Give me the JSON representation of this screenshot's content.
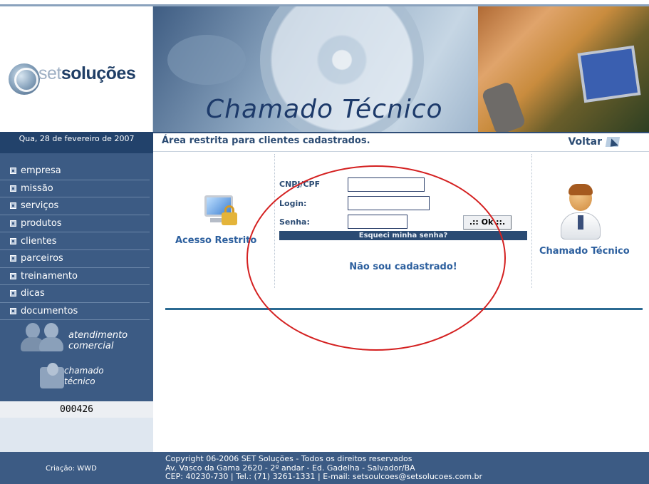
{
  "header": {
    "logo_set": "set",
    "logo_solucoes": "soluções",
    "banner_title": "Chamado Técnico"
  },
  "sidebar": {
    "date": "Qua, 28 de fevereiro de 2007",
    "items": [
      {
        "label": "empresa"
      },
      {
        "label": "missão"
      },
      {
        "label": "serviços"
      },
      {
        "label": "produtos"
      },
      {
        "label": "clientes"
      },
      {
        "label": "parceiros"
      },
      {
        "label": "treinamento"
      },
      {
        "label": "dicas"
      },
      {
        "label": "documentos"
      }
    ],
    "atendimento_line1": "atendimento",
    "atendimento_line2": "comercial",
    "chamado_line1": "chamado",
    "chamado_line2": "técnico",
    "counter": "000426"
  },
  "subheader": {
    "restricted_text": "Área restrita para clientes cadastrados.",
    "voltar_label": "Voltar"
  },
  "main": {
    "acesso_restrito_label": "Acesso Restrito",
    "chamado_tecnico_label": "Chamado Técnico",
    "form": {
      "cnpj_label": "CNPJ/CPF",
      "cnpj_value": "",
      "login_label": "Login:",
      "login_value": "",
      "senha_label": "Senha:",
      "senha_value": "",
      "ok_label": ".:: Ok ::.",
      "forgot_label": "Esqueci minha senha?",
      "not_registered_label": "Não sou cadastrado!"
    }
  },
  "footer": {
    "credit": "Criação: WWD",
    "line1": "Copyright 06-2006 SET Soluções - Todos os direitos reservados",
    "line2": "Av. Vasco da Gama 2620 - 2º andar - Ed. Gadelha - Salvador/BA",
    "line3": "CEP: 40230-730 | Tel.: (71) 3261-1331 | E-mail: setsoulcoes@setsolucoes.com.br"
  },
  "colors": {
    "nav_bg": "#3c5b84",
    "dark_blue": "#22426b",
    "link_blue": "#2c5f9e",
    "annotation_red": "#d42020"
  }
}
